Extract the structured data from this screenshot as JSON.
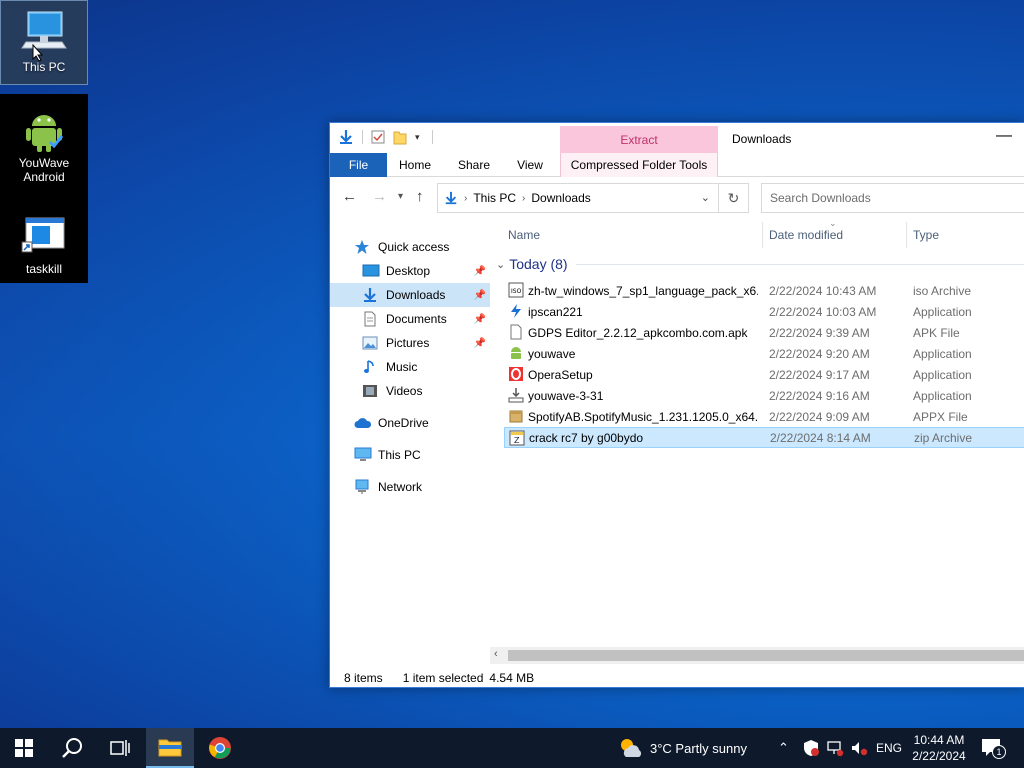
{
  "desktop": {
    "icons": [
      {
        "label": "This PC"
      },
      {
        "label": "YouWave Android"
      },
      {
        "label": "taskkill"
      }
    ]
  },
  "explorer": {
    "context_tab_head": "Extract",
    "window_title": "Downloads",
    "ribbon_tabs": {
      "file": "File",
      "home": "Home",
      "share": "Share",
      "view": "View",
      "context": "Compressed Folder Tools"
    },
    "address": {
      "segments": [
        "This PC",
        "Downloads"
      ]
    },
    "search_placeholder": "Search Downloads",
    "nav": {
      "quick_access": "Quick access",
      "desktop": "Desktop",
      "downloads": "Downloads",
      "documents": "Documents",
      "pictures": "Pictures",
      "music": "Music",
      "videos": "Videos",
      "onedrive": "OneDrive",
      "this_pc": "This PC",
      "network": "Network"
    },
    "columns": {
      "name": "Name",
      "date": "Date modified",
      "type": "Type"
    },
    "group_label": "Today (8)",
    "files": [
      {
        "name": "zh-tw_windows_7_sp1_language_pack_x6...",
        "date": "2/22/2024 10:43 AM",
        "type": "iso Archive"
      },
      {
        "name": "ipscan221",
        "date": "2/22/2024 10:03 AM",
        "type": "Application"
      },
      {
        "name": "GDPS Editor_2.2.12_apkcombo.com.apk",
        "date": "2/22/2024 9:39 AM",
        "type": "APK File"
      },
      {
        "name": "youwave",
        "date": "2/22/2024 9:20 AM",
        "type": "Application"
      },
      {
        "name": "OperaSetup",
        "date": "2/22/2024 9:17 AM",
        "type": "Application"
      },
      {
        "name": "youwave-3-31",
        "date": "2/22/2024 9:16 AM",
        "type": "Application"
      },
      {
        "name": "SpotifyAB.SpotifyMusic_1.231.1205.0_x64...",
        "date": "2/22/2024 9:09 AM",
        "type": "APPX File"
      },
      {
        "name": "crack rc7 by g00bydo",
        "date": "2/22/2024 8:14 AM",
        "type": "zip Archive"
      }
    ],
    "status": {
      "items": "8 items",
      "selected": "1 item selected",
      "size": "4.54 MB"
    }
  },
  "taskbar": {
    "weather": "3°C  Partly sunny",
    "lang": "ENG",
    "time": "10:44 AM",
    "date": "2/22/2024",
    "notif_count": "1"
  }
}
